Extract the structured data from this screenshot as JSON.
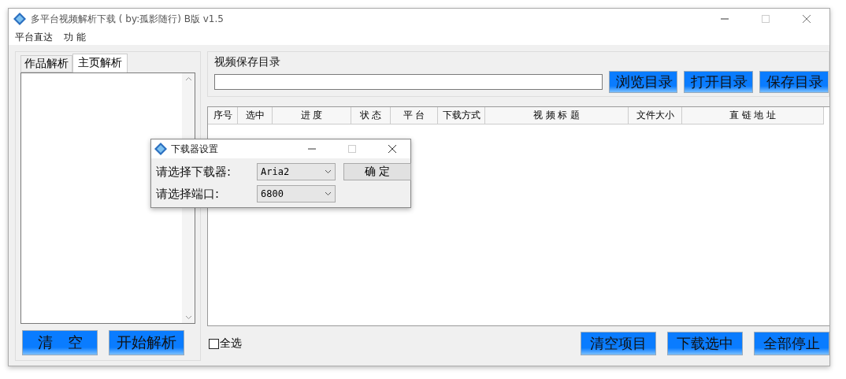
{
  "window": {
    "title": "多平台视频解析下载 ( by:孤影随行) B版 v1.5"
  },
  "menu": [
    "平台直达",
    "功 能"
  ],
  "left_panel": {
    "tabs": [
      {
        "label": "作品解析",
        "selected": false
      },
      {
        "label": "主页解析",
        "selected": true
      }
    ],
    "buttons": [
      "清　空",
      "开始解析"
    ]
  },
  "save_dir": {
    "label": "视频保存目录",
    "buttons": [
      "浏览目录",
      "打开目录",
      "保存目录"
    ]
  },
  "table": {
    "columns": [
      "序号",
      "选中",
      "进 度",
      "状 态",
      "平 台",
      "下载方式",
      "视 频 标 题",
      "文件大小",
      "直 链 地 址"
    ]
  },
  "select_all": {
    "label": "全选",
    "checked": false
  },
  "bottom_buttons": [
    "清空项目",
    "下载选中",
    "全部停止"
  ],
  "dialog": {
    "title": "下载器设置",
    "fields": [
      {
        "label": "请选择下载器:",
        "value": "Aria2"
      },
      {
        "label": "请选择端口:",
        "value": "6800"
      }
    ],
    "button": "确 定"
  }
}
